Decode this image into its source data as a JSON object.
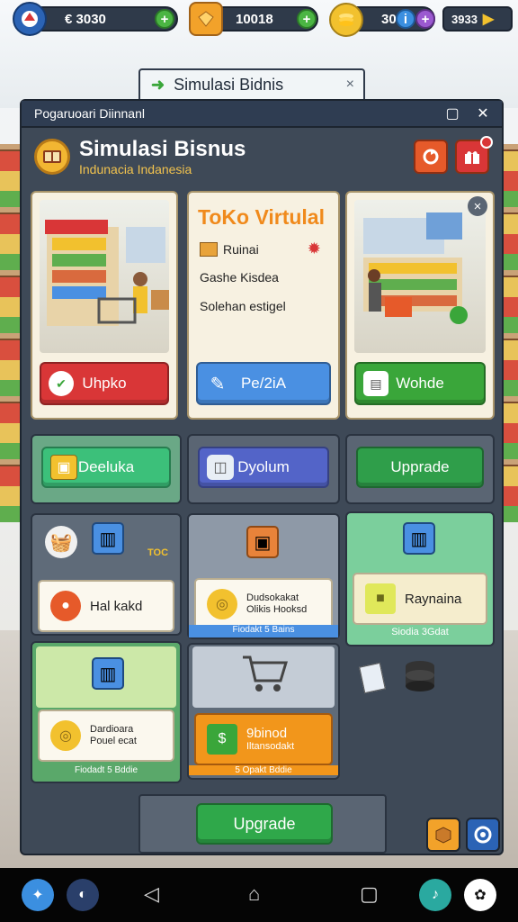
{
  "hud": {
    "avatar_icon": "avatar-icon",
    "coins_value": "€ 3030",
    "gems_value": "10018",
    "gold_value": "30",
    "energy_value": "3933"
  },
  "tab": {
    "label": "Simulasi Bidnis",
    "close": "×"
  },
  "window": {
    "title": "Pogaruoari Diinnanl",
    "maximize": "▢",
    "close": "✕"
  },
  "header": {
    "title": "Simulasi Bisnus",
    "subtitle": "Indunacia Indanesia"
  },
  "cards": [
    {
      "title": "",
      "button": "Uhpko",
      "color": "#d93637"
    },
    {
      "title": "ToKo Virtulal",
      "lines": [
        "Ruinai",
        "Gashe Kisdea",
        "Solehan estigel"
      ],
      "button": "Pe/2iA",
      "color": "#4a90e2"
    },
    {
      "title": "",
      "button": "Wohde",
      "color": "#3aa63a",
      "close": "×"
    }
  ],
  "row2": [
    {
      "label": "Deeluka",
      "color": "#3cc07a"
    },
    {
      "label": "Dyolum",
      "color": "#5364c8"
    },
    {
      "label": "Upprade",
      "color": "#2f9e4a"
    }
  ],
  "grid": {
    "a_tag": "TOC",
    "a_item": "Hal kakd",
    "b_item_line1": "Dudsokakat",
    "b_item_line2": "Olikis Hooksd",
    "b_caption": "Fiodakt 5 Bains",
    "c_item": "Raynaina",
    "c_caption": "Siodia 3Gdat",
    "d_item_line1": "Dardioara",
    "d_item_line2": "Pouel ecat",
    "d_caption": "Fiodadt 5 Bddie",
    "e_item_line1": "9binod",
    "e_item_line2": "Iltansodakt",
    "e_caption": "5 Opakt Bddie"
  },
  "bottom": {
    "upgrade": "Upgrade"
  },
  "colors": {
    "panel": "#3e4957",
    "accent_green": "#2fa84a",
    "accent_orange": "#f2961b"
  }
}
